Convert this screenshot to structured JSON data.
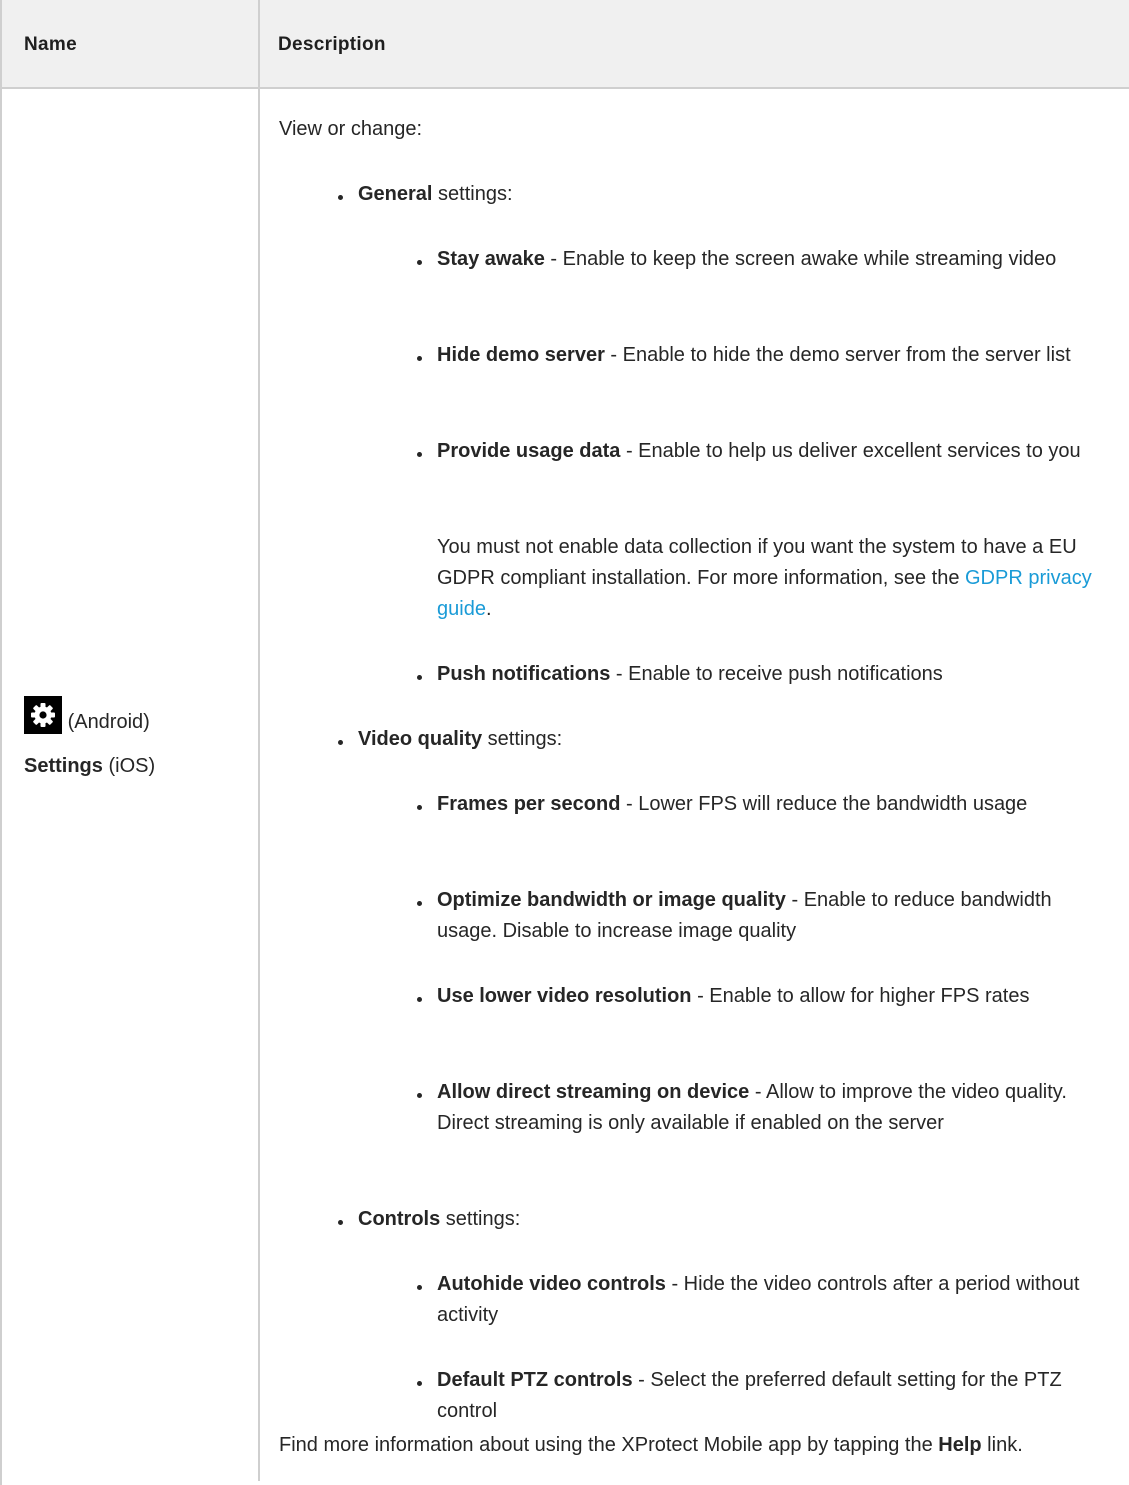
{
  "table": {
    "headers": {
      "name": "Name",
      "description": "Description"
    },
    "row": {
      "name": {
        "icon": "gear-icon",
        "android_label": "(Android)",
        "ios_bold": "Settings",
        "ios_label": "(iOS)"
      },
      "intro": "View or change:",
      "sections": [
        {
          "bold": "General",
          "rest": " settings:",
          "items": [
            {
              "bold": "Stay awake",
              "text": " - Enable to keep the screen awake while streaming video"
            },
            {
              "bold": "Hide demo server",
              "text": " - Enable to hide the demo server from the server list"
            },
            {
              "bold": "Provide usage data",
              "text": " - Enable to help us deliver excellent services to you"
            },
            {
              "bold": "Push notifications",
              "text": " - Enable to receive push notifications"
            }
          ],
          "note": {
            "text": "You must not enable data collection if you want the system to have a EU GDPR compliant installation.  For more information, see the ",
            "link": "GDPR privacy guide",
            "end": "."
          }
        },
        {
          "bold": "Video quality",
          "rest": " settings:",
          "items": [
            {
              "bold": "Frames per second",
              "text": " - Lower FPS will reduce the bandwidth usage"
            },
            {
              "bold": "Optimize bandwidth or image quality",
              "text": " - Enable to reduce bandwidth usage. Disable to increase image quality"
            },
            {
              "bold": "Use lower video resolution",
              "text": " - Enable to allow for higher FPS rates"
            },
            {
              "bold": "Allow direct streaming on device",
              "text": " - Allow to improve the video quality. Direct streaming is only available if enabled on the server"
            }
          ]
        },
        {
          "bold": "Controls",
          "rest": " settings:",
          "items": [
            {
              "bold": "Autohide video controls",
              "text": " - Hide the video controls after a period without activity"
            },
            {
              "bold": "Default PTZ controls",
              "text": " - Select the preferred default setting for the PTZ control"
            }
          ]
        }
      ],
      "footer": {
        "text": "Find more information about using the XProtect Mobile app by tapping the ",
        "bold": "Help",
        "end": " link."
      }
    }
  }
}
